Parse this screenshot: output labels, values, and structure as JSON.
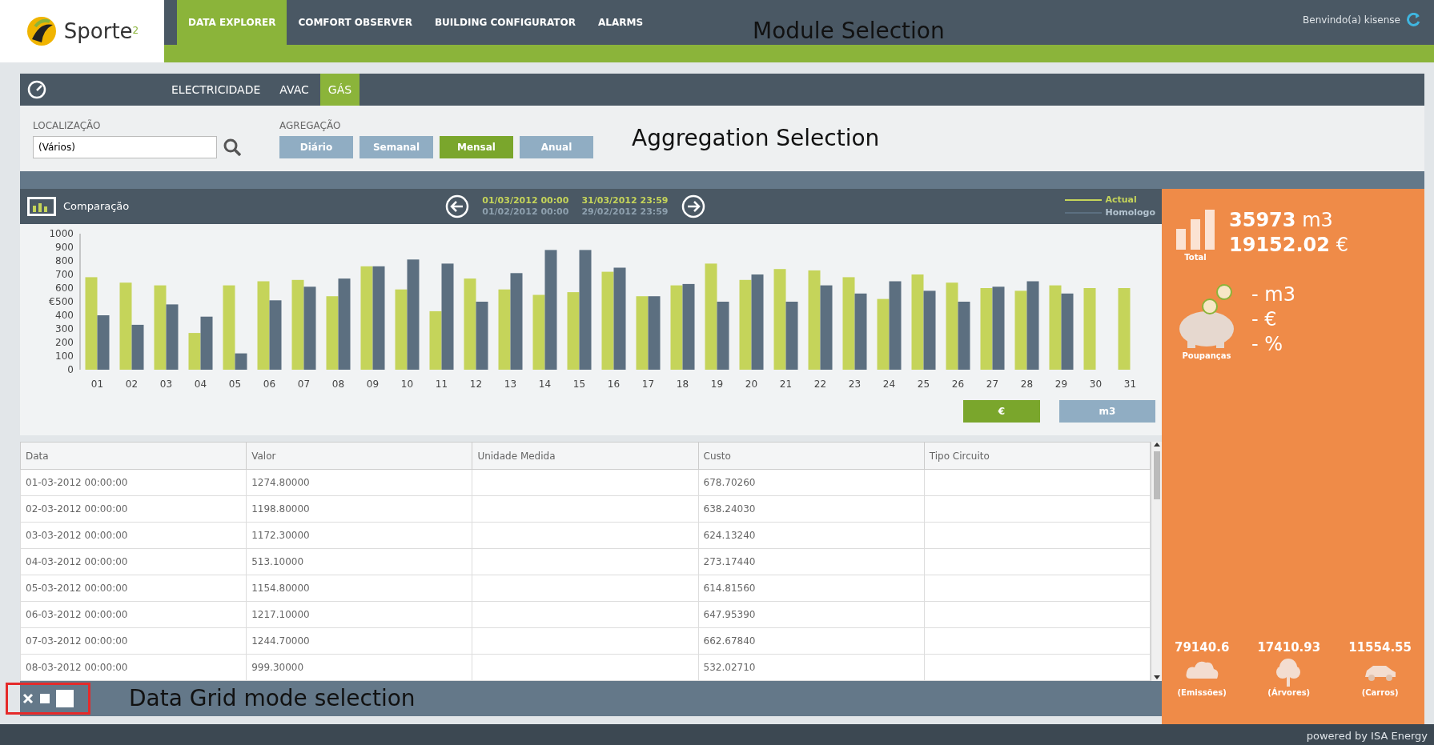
{
  "header": {
    "logo": "Sporte$^{2}$",
    "modules": [
      {
        "label": "DATA EXPLORER",
        "selected": true
      },
      {
        "label": "COMFORT OBSERVER",
        "selected": false
      },
      {
        "label": "BUILDING CONFIGURATOR",
        "selected": false
      },
      {
        "label": "ALARMS",
        "selected": false
      }
    ],
    "annotation": "Module Selection",
    "greeting": "Benvindo(a) kisense"
  },
  "energy_tabs": [
    {
      "label": "ELECTRICIDADE",
      "selected": false
    },
    {
      "label": "AVAC",
      "selected": false
    },
    {
      "label": "GÁS",
      "selected": true
    }
  ],
  "filters": {
    "location_label": "LOCALIZAÇÃO",
    "location_value": "(Vários)",
    "aggregation_label": "AGREGAÇÃO",
    "aggregation": [
      {
        "label": "Diário",
        "selected": false
      },
      {
        "label": "Semanal",
        "selected": false
      },
      {
        "label": "Mensal",
        "selected": true
      },
      {
        "label": "Anual",
        "selected": false
      }
    ],
    "annotation": "Aggregation Selection"
  },
  "chart_panel": {
    "title": "Comparação",
    "periods": [
      {
        "start": "01/03/2012 00:00",
        "end": "31/03/2012 23:59",
        "kind": "current"
      },
      {
        "start": "01/02/2012 00:00",
        "end": "29/02/2012 23:59",
        "kind": "previous"
      }
    ],
    "chart_data": {
      "type": "bar",
      "ylabel": "€",
      "categories": [
        "01",
        "02",
        "03",
        "04",
        "05",
        "06",
        "07",
        "08",
        "09",
        "10",
        "11",
        "12",
        "13",
        "14",
        "15",
        "16",
        "17",
        "18",
        "19",
        "20",
        "21",
        "22",
        "23",
        "24",
        "25",
        "26",
        "27",
        "28",
        "29",
        "30",
        "31"
      ],
      "series": [
        {
          "name": "Actual",
          "color": "#c5d45a",
          "values": [
            680,
            640,
            620,
            270,
            620,
            650,
            660,
            540,
            760,
            590,
            430,
            670,
            590,
            550,
            570,
            720,
            540,
            620,
            780,
            660,
            740,
            730,
            680,
            520,
            700,
            640,
            600,
            580,
            620,
            600,
            600
          ]
        },
        {
          "name": "Homologo",
          "color": "#5c6f80",
          "values": [
            400,
            330,
            480,
            390,
            120,
            510,
            610,
            670,
            760,
            810,
            780,
            500,
            710,
            880,
            880,
            750,
            540,
            630,
            500,
            700,
            500,
            620,
            560,
            650,
            580,
            500,
            610,
            650,
            560,
            null,
            null
          ]
        }
      ],
      "ylim": [
        0,
        1000
      ],
      "yticks": [
        0,
        100,
        200,
        300,
        400,
        500,
        600,
        700,
        800,
        900,
        1000
      ]
    },
    "units": [
      {
        "label": "€",
        "selected": true
      },
      {
        "label": "m3",
        "selected": false
      }
    ]
  },
  "table": {
    "columns": [
      "Data",
      "Valor",
      "Unidade Medida",
      "Custo",
      "Tipo Circuito"
    ],
    "rows": [
      {
        "data": "01-03-2012 00:00:00",
        "valor": "1274.80000",
        "custo": "678.70260"
      },
      {
        "data": "02-03-2012 00:00:00",
        "valor": "1198.80000",
        "custo": "638.24030"
      },
      {
        "data": "03-03-2012 00:00:00",
        "valor": "1172.30000",
        "custo": "624.13240"
      },
      {
        "data": "04-03-2012 00:00:00",
        "valor": "513.10000",
        "custo": "273.17440"
      },
      {
        "data": "05-03-2012 00:00:00",
        "valor": "1154.80000",
        "custo": "614.81560"
      },
      {
        "data": "06-03-2012 00:00:00",
        "valor": "1217.10000",
        "custo": "647.95390"
      },
      {
        "data": "07-03-2012 00:00:00",
        "valor": "1244.70000",
        "custo": "662.67840"
      },
      {
        "data": "08-03-2012 00:00:00",
        "valor": "999.30000",
        "custo": "532.02710"
      }
    ]
  },
  "grid_mode": {
    "annotation": "Data Grid mode selection"
  },
  "summary": {
    "total_label": "Total",
    "total_volume": "**35973** m3",
    "total_cost": "**19152.02** €",
    "savings_label": "Poupanças",
    "savings": [
      "- m3",
      "- €",
      "- %"
    ],
    "equivalents": [
      {
        "value": "79140.6",
        "label": "(Emissões)",
        "kind": "co2"
      },
      {
        "value": "17410.93",
        "label": "(Árvores)",
        "kind": "tree"
      },
      {
        "value": "11554.55",
        "label": "(Carros)",
        "kind": "car"
      }
    ]
  },
  "footer": "powered by ISA Energy"
}
